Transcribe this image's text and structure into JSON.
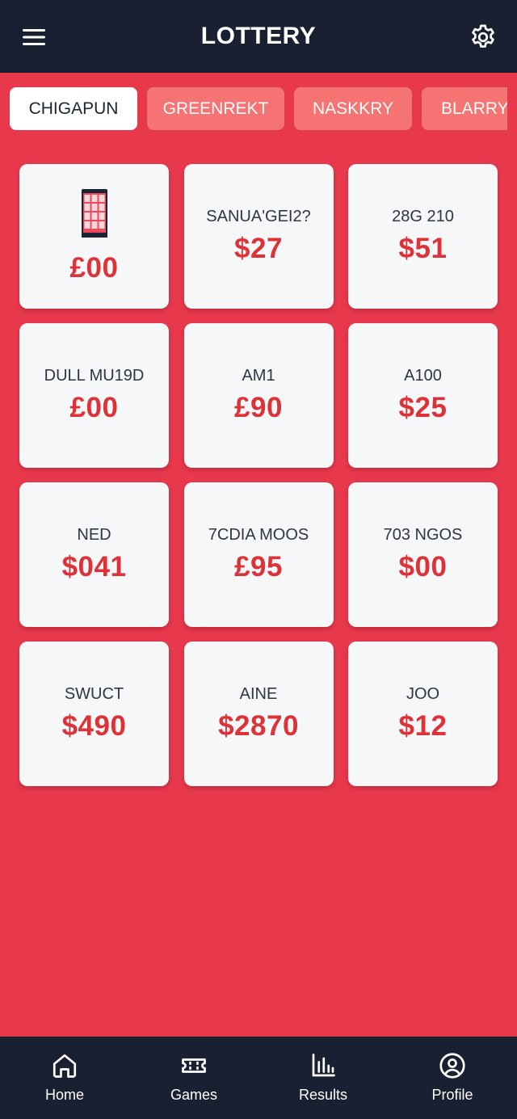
{
  "header": {
    "title": "LOTTERY",
    "menu_icon": "hamburger-menu-icon",
    "settings_icon": "gear-icon"
  },
  "tabs": [
    {
      "label": "CHIGAPUN",
      "active": true
    },
    {
      "label": "GREENREKT",
      "active": false
    },
    {
      "label": "NASKKRY",
      "active": false
    },
    {
      "label": "BLARRY",
      "active": false
    }
  ],
  "cards": [
    {
      "title": "",
      "amount": "£00",
      "has_thumbnail": true
    },
    {
      "title": "SANUA'GEI2?",
      "amount": "$27"
    },
    {
      "title": "28G 210",
      "amount": "$51"
    },
    {
      "title": "DULL MU19D",
      "amount": "£00"
    },
    {
      "title": "AM1",
      "amount": "£90"
    },
    {
      "title": "A100",
      "amount": "$25"
    },
    {
      "title": "NED",
      "amount": "$041"
    },
    {
      "title": "7CDIA MOOS",
      "amount": "£95"
    },
    {
      "title": "703 NGOS",
      "amount": "$00"
    },
    {
      "title": "SWUCT",
      "amount": "$490"
    },
    {
      "title": "AINE",
      "amount": "$2870"
    },
    {
      "title": "JOO",
      "amount": "$12"
    }
  ],
  "nav": [
    {
      "label": "Home",
      "icon": "home-icon"
    },
    {
      "label": "Games",
      "icon": "ticket-icon"
    },
    {
      "label": "Results",
      "icon": "bar-chart-icon"
    },
    {
      "label": "Profile",
      "icon": "user-circle-icon"
    }
  ],
  "colors": {
    "background": "#e8384c",
    "header": "#182032",
    "accent": "#dd3237",
    "tab_inactive": "#f57373"
  }
}
